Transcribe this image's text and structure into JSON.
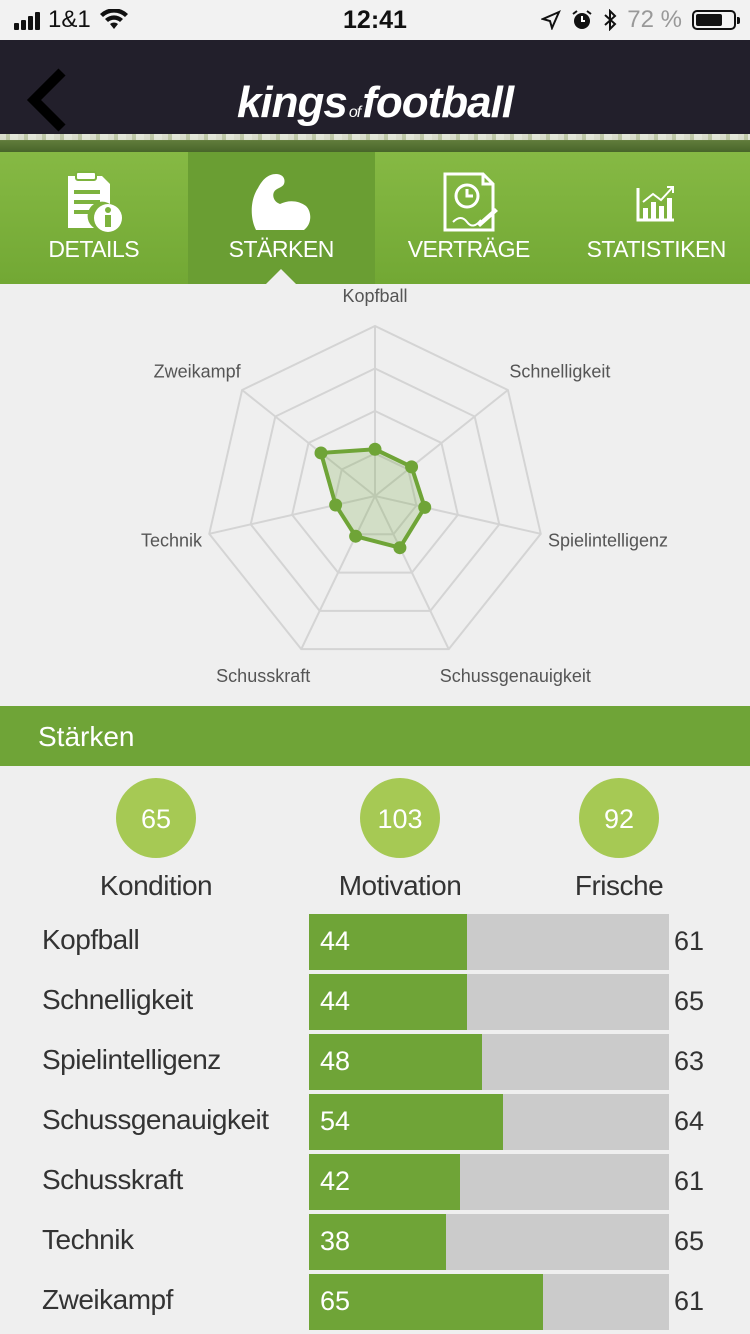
{
  "status": {
    "carrier": "1&1",
    "time": "12:41",
    "battery": "72 %",
    "battery_level": 0.72
  },
  "header": {
    "logo_main_1": "kings",
    "logo_of": "of",
    "logo_main_2": "football"
  },
  "tabs": [
    {
      "label": "DETAILS",
      "icon": "document-info-icon",
      "active": false
    },
    {
      "label": "STÄRKEN",
      "icon": "flexed-arm-icon",
      "active": true
    },
    {
      "label": "VERTRÄGE",
      "icon": "contract-clock-icon",
      "active": false
    },
    {
      "label": "STATISTIKEN",
      "icon": "bar-chart-icon",
      "active": false
    }
  ],
  "chart_data": {
    "type": "radar",
    "categories": [
      "Kopfball",
      "Schnelligkeit",
      "Spielintelligenz",
      "Schussgenauigkeit",
      "Schusskraft",
      "Technik",
      "Zweikampf"
    ],
    "values": [
      44,
      44,
      48,
      54,
      42,
      38,
      65
    ],
    "rmax": 160,
    "rings": 4,
    "grid": true,
    "color": "#6fa437"
  },
  "section_title": "Stärken",
  "metrics": [
    {
      "value": "65",
      "label": "Kondition"
    },
    {
      "value": "103",
      "label": "Motivation"
    },
    {
      "value": "92",
      "label": "Frische"
    }
  ],
  "bars": {
    "scale_max": 100,
    "items": [
      {
        "name": "Kopfball",
        "value": 44,
        "max": 61
      },
      {
        "name": "Schnelligkeit",
        "value": 44,
        "max": 65
      },
      {
        "name": "Spielintelligenz",
        "value": 48,
        "max": 63
      },
      {
        "name": "Schussgenauigkeit",
        "value": 54,
        "max": 64
      },
      {
        "name": "Schusskraft",
        "value": 42,
        "max": 61
      },
      {
        "name": "Technik",
        "value": 38,
        "max": 65
      },
      {
        "name": "Zweikampf",
        "value": 65,
        "max": 61
      }
    ]
  }
}
